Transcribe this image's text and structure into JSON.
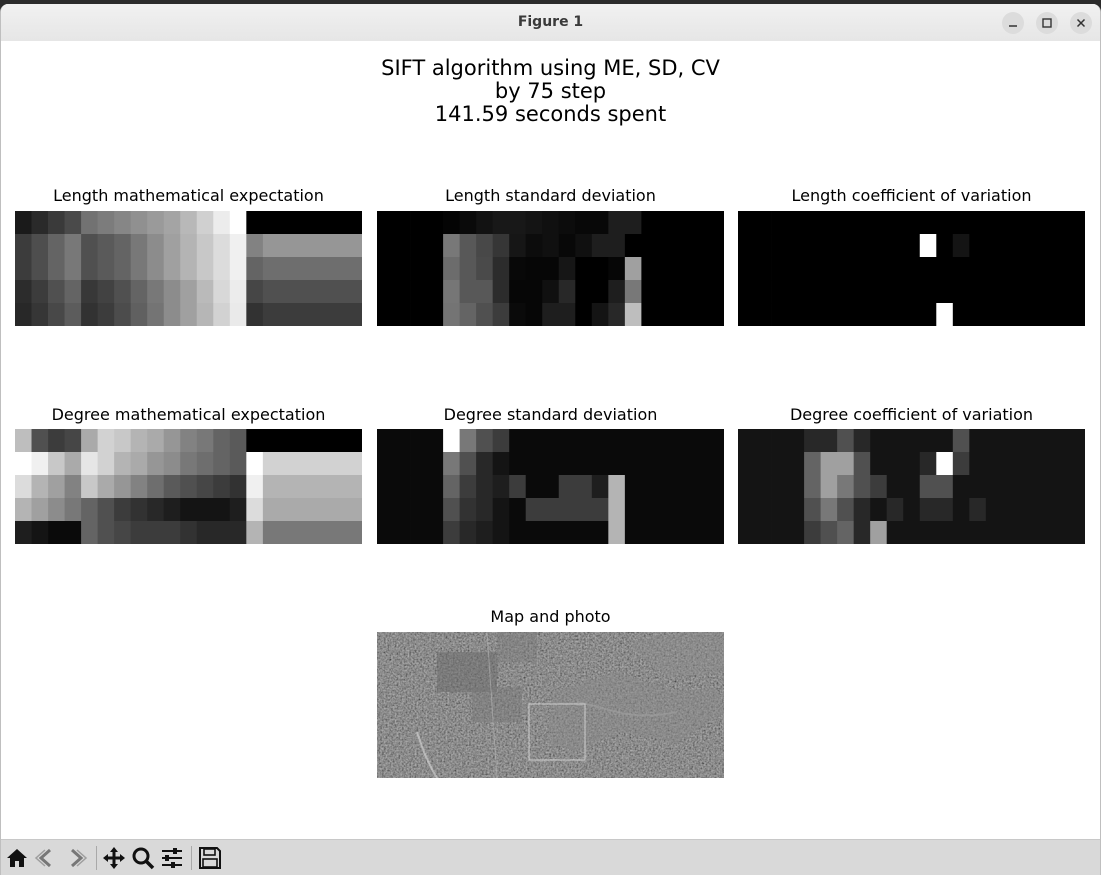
{
  "window": {
    "title": "Figure 1",
    "controls": [
      "minimize-icon",
      "maximize-icon",
      "close-icon"
    ]
  },
  "figure": {
    "suptitle_lines": [
      "SIFT algorithm using ME, SD, CV",
      "by 75 step",
      "141.59 seconds spent"
    ],
    "panels": [
      {
        "title": "Length mathematical expectation",
        "grid": [
          [
            26,
            42,
            58,
            74,
            114,
            124,
            134,
            144,
            154,
            164,
            184,
            208,
            236,
            255,
            0,
            0,
            0,
            0,
            0,
            0,
            0
          ],
          [
            60,
            78,
            100,
            120,
            80,
            90,
            100,
            120,
            140,
            160,
            180,
            200,
            220,
            240,
            130,
            150,
            150,
            150,
            150,
            150,
            150
          ],
          [
            60,
            78,
            100,
            120,
            80,
            90,
            100,
            120,
            140,
            160,
            180,
            200,
            220,
            240,
            100,
            110,
            110,
            110,
            110,
            110,
            110
          ],
          [
            44,
            60,
            80,
            100,
            56,
            66,
            80,
            100,
            120,
            140,
            160,
            186,
            216,
            236,
            70,
            80,
            80,
            80,
            80,
            80,
            80
          ],
          [
            40,
            54,
            72,
            92,
            50,
            60,
            76,
            96,
            116,
            140,
            160,
            182,
            210,
            234,
            50,
            60,
            60,
            60,
            60,
            60,
            60
          ]
        ]
      },
      {
        "title": "Length standard deviation",
        "grid": [
          [
            0,
            0,
            0,
            0,
            4,
            10,
            18,
            24,
            24,
            20,
            16,
            12,
            8,
            8,
            30,
            30,
            0,
            0,
            0,
            0,
            0
          ],
          [
            0,
            0,
            0,
            0,
            120,
            88,
            72,
            54,
            22,
            12,
            16,
            8,
            16,
            30,
            30,
            0,
            0,
            0,
            0,
            0,
            0
          ],
          [
            0,
            0,
            0,
            0,
            108,
            88,
            74,
            44,
            8,
            6,
            6,
            22,
            0,
            0,
            6,
            160,
            0,
            0,
            0,
            0,
            0
          ],
          [
            0,
            0,
            0,
            0,
            118,
            88,
            88,
            44,
            6,
            6,
            16,
            40,
            0,
            0,
            30,
            120,
            0,
            0,
            0,
            0,
            0
          ],
          [
            0,
            0,
            0,
            0,
            116,
            100,
            80,
            60,
            10,
            6,
            30,
            30,
            0,
            20,
            40,
            190,
            0,
            0,
            0,
            0,
            0
          ]
        ]
      },
      {
        "title": "Length coefficient of variation",
        "grid": [
          [
            0,
            0,
            0,
            0,
            0,
            0,
            0,
            0,
            0,
            0,
            0,
            0,
            0,
            0,
            0,
            0,
            0,
            0,
            0,
            0,
            0
          ],
          [
            0,
            0,
            0,
            0,
            0,
            0,
            0,
            0,
            0,
            0,
            0,
            255,
            0,
            20,
            0,
            0,
            0,
            0,
            0,
            0,
            0
          ],
          [
            0,
            0,
            0,
            0,
            0,
            0,
            0,
            0,
            0,
            0,
            0,
            0,
            0,
            0,
            0,
            0,
            0,
            0,
            0,
            0,
            0
          ],
          [
            0,
            0,
            0,
            0,
            0,
            0,
            0,
            0,
            0,
            0,
            0,
            0,
            0,
            0,
            0,
            0,
            0,
            0,
            0,
            0,
            0
          ],
          [
            0,
            0,
            0,
            0,
            0,
            0,
            0,
            0,
            0,
            0,
            0,
            0,
            255,
            0,
            0,
            0,
            0,
            0,
            0,
            0,
            0
          ]
        ]
      },
      {
        "title": "Degree mathematical expectation",
        "grid": [
          [
            190,
            80,
            60,
            70,
            170,
            210,
            200,
            180,
            170,
            150,
            130,
            120,
            100,
            90,
            0,
            0,
            0,
            0,
            0,
            0,
            0
          ],
          [
            255,
            240,
            200,
            170,
            230,
            210,
            180,
            170,
            150,
            140,
            120,
            110,
            100,
            90,
            255,
            210,
            210,
            210,
            210,
            210,
            210
          ],
          [
            220,
            180,
            160,
            130,
            200,
            170,
            150,
            130,
            110,
            90,
            80,
            70,
            60,
            50,
            240,
            180,
            180,
            180,
            180,
            180,
            180
          ],
          [
            180,
            160,
            140,
            120,
            100,
            80,
            60,
            50,
            40,
            30,
            20,
            20,
            20,
            30,
            220,
            170,
            170,
            170,
            170,
            170,
            170
          ],
          [
            30,
            20,
            10,
            10,
            100,
            80,
            70,
            60,
            60,
            60,
            50,
            40,
            40,
            40,
            180,
            120,
            120,
            120,
            120,
            120,
            120
          ]
        ]
      },
      {
        "title": "Degree standard deviation",
        "grid": [
          [
            10,
            10,
            10,
            10,
            255,
            120,
            80,
            60,
            10,
            10,
            10,
            10,
            10,
            10,
            10,
            10,
            10,
            10,
            10,
            10,
            10
          ],
          [
            10,
            10,
            10,
            10,
            120,
            80,
            40,
            20,
            10,
            10,
            10,
            10,
            10,
            10,
            10,
            10,
            10,
            10,
            10,
            10,
            10
          ],
          [
            10,
            10,
            10,
            10,
            100,
            60,
            40,
            30,
            60,
            10,
            10,
            60,
            60,
            30,
            180,
            10,
            10,
            10,
            10,
            10,
            10
          ],
          [
            10,
            10,
            10,
            10,
            80,
            50,
            40,
            20,
            10,
            60,
            60,
            60,
            60,
            60,
            180,
            10,
            10,
            10,
            10,
            10,
            10
          ],
          [
            10,
            10,
            10,
            10,
            60,
            40,
            30,
            20,
            10,
            10,
            10,
            10,
            10,
            10,
            180,
            10,
            10,
            10,
            10,
            10,
            10
          ]
        ]
      },
      {
        "title": "Degree coefficient of variation",
        "grid": [
          [
            20,
            20,
            20,
            20,
            40,
            40,
            80,
            40,
            20,
            20,
            20,
            20,
            20,
            80,
            20,
            20,
            20,
            20,
            20,
            20,
            20
          ],
          [
            20,
            20,
            20,
            20,
            100,
            160,
            160,
            80,
            20,
            20,
            20,
            40,
            255,
            60,
            20,
            20,
            20,
            20,
            20,
            20,
            20
          ],
          [
            20,
            20,
            20,
            20,
            100,
            160,
            120,
            80,
            60,
            20,
            20,
            80,
            80,
            20,
            20,
            20,
            20,
            20,
            20,
            20,
            20
          ],
          [
            20,
            20,
            20,
            20,
            80,
            120,
            80,
            40,
            20,
            40,
            20,
            40,
            40,
            20,
            40,
            20,
            20,
            20,
            20,
            20,
            20
          ],
          [
            20,
            20,
            20,
            20,
            60,
            80,
            100,
            40,
            160,
            20,
            20,
            20,
            20,
            20,
            20,
            20,
            20,
            20,
            20,
            20,
            20
          ]
        ]
      }
    ],
    "map_title": "Map and photo"
  },
  "toolbar": {
    "icons": [
      "home-icon",
      "back-icon",
      "forward-icon",
      "pan-icon",
      "zoom-icon",
      "configure-subplots-icon",
      "save-icon"
    ]
  }
}
